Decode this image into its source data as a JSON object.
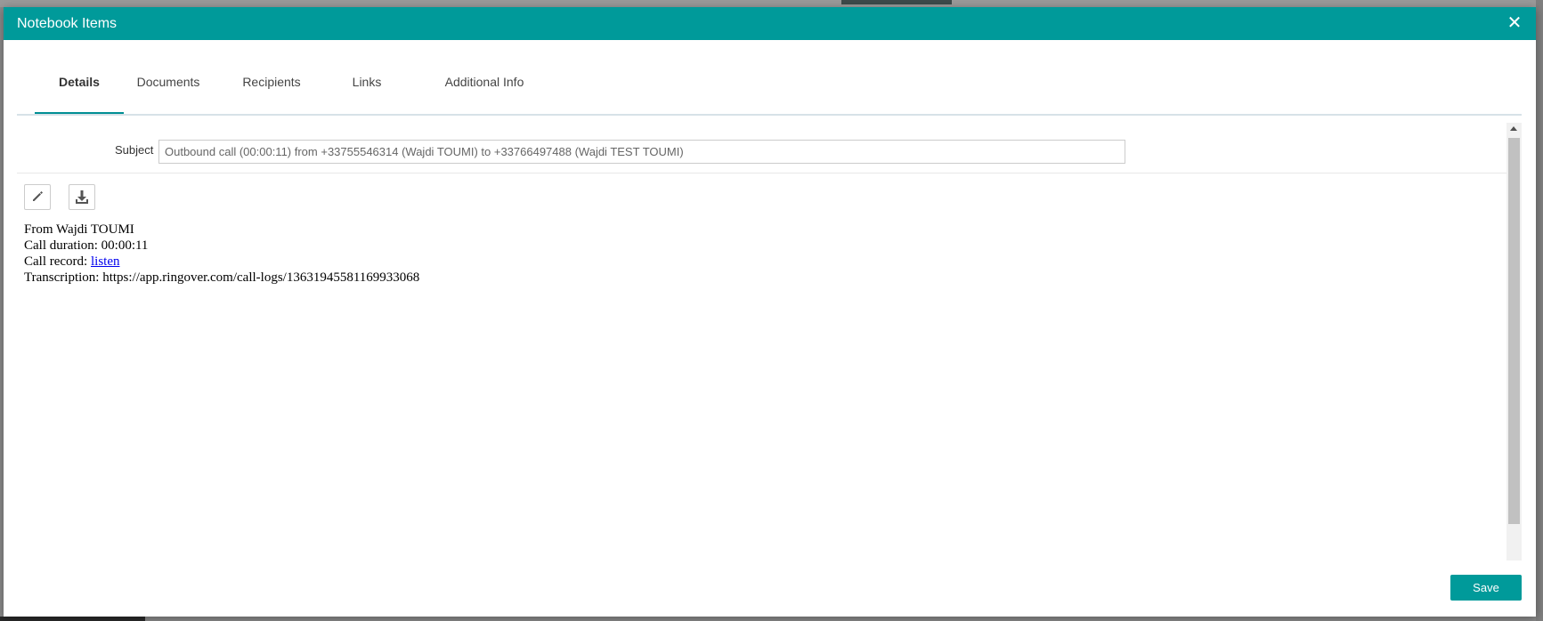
{
  "modal": {
    "title": "Notebook Items",
    "close_glyph": "✕"
  },
  "tabs": [
    {
      "label": "Details",
      "active": true
    },
    {
      "label": "Documents",
      "active": false
    },
    {
      "label": "Recipients",
      "active": false
    },
    {
      "label": "Links",
      "active": false
    },
    {
      "label": "Additional Info",
      "active": false
    }
  ],
  "details": {
    "subject_label": "Subject",
    "subject_value": "Outbound call (00:00:11) from +33755546314 (Wajdi TOUMI) to +33766497488 (Wajdi TEST TOUMI)",
    "toolbar": {
      "edit_icon": "pencil-icon",
      "download_icon": "download-icon"
    },
    "body": {
      "line1": "From Wajdi TOUMI",
      "line2": "Call duration: 00:00:11",
      "line3_prefix": "Call record: ",
      "line3_link": "listen",
      "line4": "Transcription: https://app.ringover.com/call-logs/13631945581169933068"
    }
  },
  "footer": {
    "save_label": "Save"
  },
  "colors": {
    "header_bg": "#009a9a",
    "tab_active_underline": "#008e94",
    "link": "#0000ee"
  }
}
